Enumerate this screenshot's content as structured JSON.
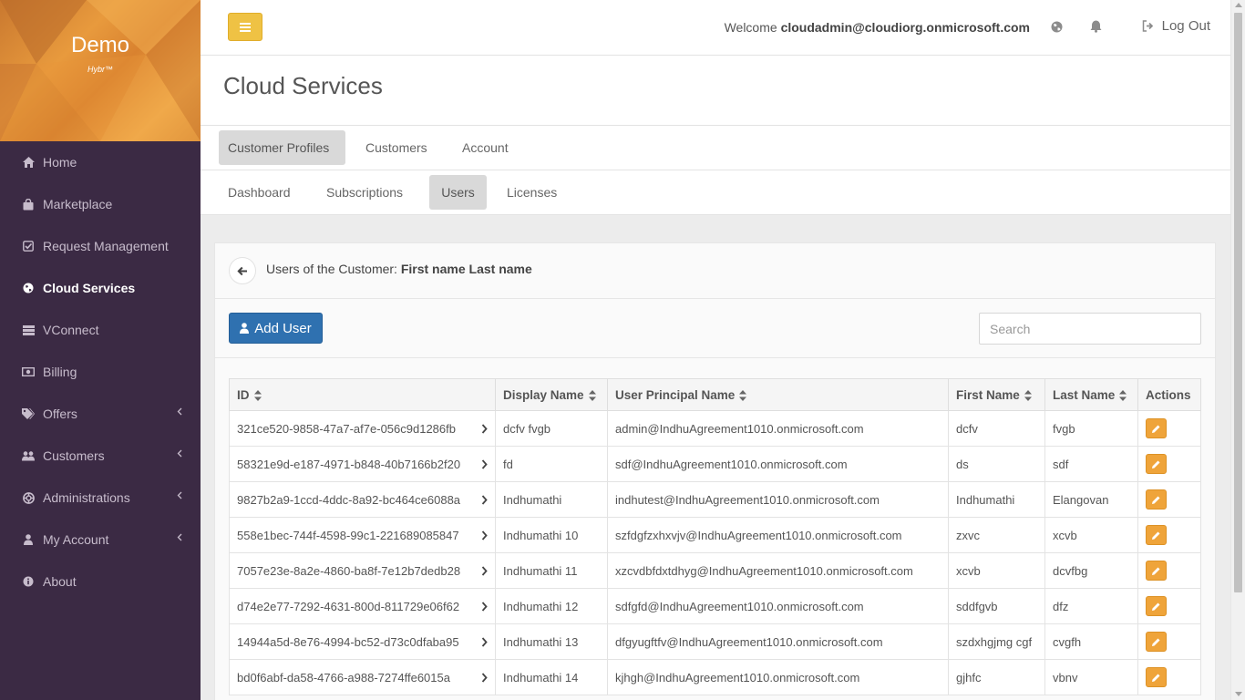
{
  "brand": {
    "title": "Demo",
    "subtitle": "Hybr™"
  },
  "sidebar": {
    "items": [
      {
        "label": "Home",
        "icon": "home-icon",
        "active": false,
        "chevron": false
      },
      {
        "label": "Marketplace",
        "icon": "shopping-bag-icon",
        "active": false,
        "chevron": false
      },
      {
        "label": "Request Management",
        "icon": "check-square-icon",
        "active": false,
        "chevron": false
      },
      {
        "label": "Cloud Services",
        "icon": "globe-icon",
        "active": true,
        "chevron": false
      },
      {
        "label": "VConnect",
        "icon": "server-icon",
        "active": false,
        "chevron": false
      },
      {
        "label": "Billing",
        "icon": "money-icon",
        "active": false,
        "chevron": false
      },
      {
        "label": "Offers",
        "icon": "tags-icon",
        "active": false,
        "chevron": true
      },
      {
        "label": "Customers",
        "icon": "users-icon",
        "active": false,
        "chevron": true
      },
      {
        "label": "Administrations",
        "icon": "lifebuoy-icon",
        "active": false,
        "chevron": true
      },
      {
        "label": "My Account",
        "icon": "user-icon",
        "active": false,
        "chevron": true
      },
      {
        "label": "About",
        "icon": "info-icon",
        "active": false,
        "chevron": false
      }
    ]
  },
  "topbar": {
    "welcome_prefix": "Welcome",
    "user_email": "cloudadmin@cloudiorg.onmicrosoft.com",
    "logout_label": "Log Out"
  },
  "page": {
    "title": "Cloud Services"
  },
  "tabs_primary": [
    {
      "label": "Customer Profiles",
      "active": true
    },
    {
      "label": "Customers",
      "active": false
    },
    {
      "label": "Account",
      "active": false
    }
  ],
  "tabs_secondary": [
    {
      "label": "Dashboard",
      "active": false
    },
    {
      "label": "Subscriptions",
      "active": false
    },
    {
      "label": "Users",
      "active": true
    },
    {
      "label": "Licenses",
      "active": false
    }
  ],
  "panel": {
    "title_prefix": "Users of the Customer:",
    "customer_name": "First name Last name",
    "add_user_label": "Add User",
    "search_placeholder": "Search"
  },
  "table": {
    "columns": [
      "ID",
      "Display Name",
      "User Principal Name",
      "First Name",
      "Last Name",
      "Actions"
    ],
    "rows": [
      {
        "id": "321ce520-9858-47a7-af7e-056c9d1286fb",
        "display_name": "dcfv fvgb",
        "upn": "admin@IndhuAgreement1010.onmicrosoft.com",
        "first_name": "dcfv",
        "last_name": "fvgb"
      },
      {
        "id": "58321e9d-e187-4971-b848-40b7166b2f20",
        "display_name": "fd",
        "upn": "sdf@IndhuAgreement1010.onmicrosoft.com",
        "first_name": "ds",
        "last_name": "sdf"
      },
      {
        "id": "9827b2a9-1ccd-4ddc-8a92-bc464ce6088a",
        "display_name": "Indhumathi",
        "upn": "indhutest@IndhuAgreement1010.onmicrosoft.com",
        "first_name": "Indhumathi",
        "last_name": "Elangovan"
      },
      {
        "id": "558e1bec-744f-4598-99c1-221689085847",
        "display_name": "Indhumathi 10",
        "upn": "szfdgfzxhxvjv@IndhuAgreement1010.onmicrosoft.com",
        "first_name": "zxvc",
        "last_name": "xcvb"
      },
      {
        "id": "7057e23e-8a2e-4860-ba8f-7e12b7dedb28",
        "display_name": "Indhumathi 11",
        "upn": "xzcvdbfdxtdhyg@IndhuAgreement1010.onmicrosoft.com",
        "first_name": "xcvb",
        "last_name": "dcvfbg"
      },
      {
        "id": "d74e2e77-7292-4631-800d-811729e06f62",
        "display_name": "Indhumathi 12",
        "upn": "sdfgfd@IndhuAgreement1010.onmicrosoft.com",
        "first_name": "sddfgvb",
        "last_name": "dfz"
      },
      {
        "id": "14944a5d-8e76-4994-bc52-d73c0dfaba95",
        "display_name": "Indhumathi 13",
        "upn": "dfgyugftfv@IndhuAgreement1010.onmicrosoft.com",
        "first_name": "szdxhgjmg cgf",
        "last_name": "cvgfh"
      },
      {
        "id": "bd0f6abf-da58-4766-a988-7274ffe6015a",
        "display_name": "Indhumathi 14",
        "upn": "kjhgh@IndhuAgreement1010.onmicrosoft.com",
        "first_name": "gjhfc",
        "last_name": "vbnv"
      }
    ]
  },
  "colors": {
    "sidebar_bg": "#3b2a44",
    "menu_button": "#efc244",
    "primary_button": "#2f71b0",
    "edit_button": "#efa43a"
  }
}
